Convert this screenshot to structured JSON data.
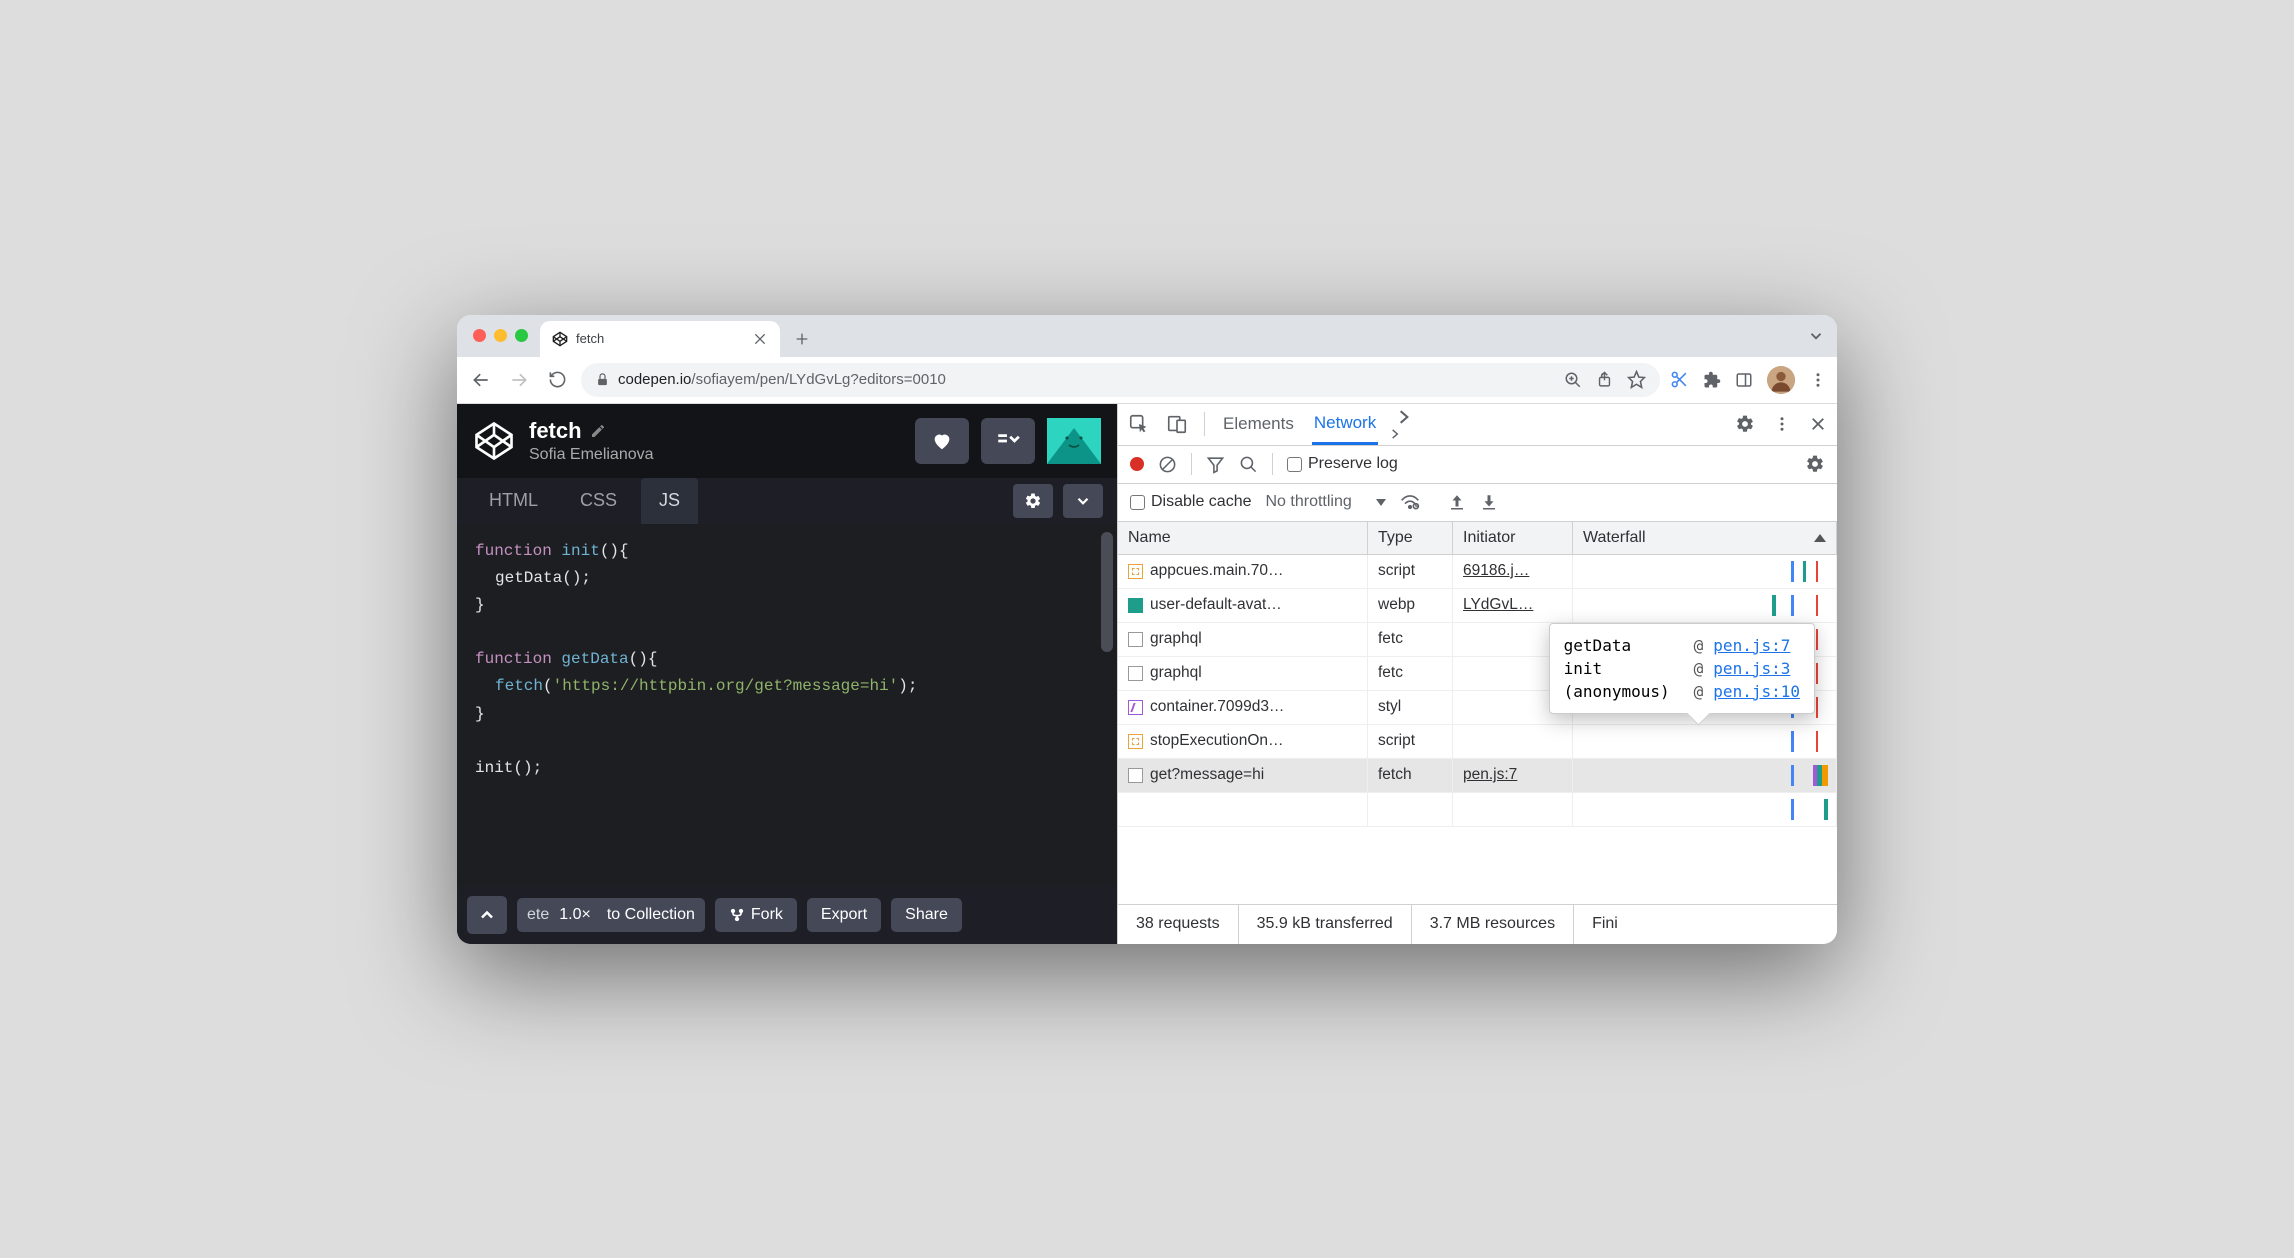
{
  "browser": {
    "tab_title": "fetch",
    "url_domain": "codepen.io",
    "url_path": "/sofiayem/pen/LYdGvLg?editors=0010"
  },
  "codepen": {
    "title": "fetch",
    "author": "Sofia Emelianova",
    "tabs": {
      "html": "HTML",
      "css": "CSS",
      "js": "JS"
    },
    "footer": {
      "truncated": "ete",
      "zoom": "1.0×",
      "collection": "to Collection",
      "fork": "Fork",
      "export": "Export",
      "share": "Share"
    },
    "code": {
      "l1_kw": "function",
      "l1_fn": "init",
      "l1_rest": "(){",
      "l2": "getData();",
      "l3": "}",
      "l4_kw": "function",
      "l4_fn": "getData",
      "l4_rest": "(){",
      "l5_fn": "fetch",
      "l5_open": "(",
      "l5_str": "'https://httpbin.org/get?message=hi'",
      "l5_close": ");",
      "l6": "}",
      "l7": "init();"
    }
  },
  "devtools": {
    "tabs": {
      "elements": "Elements",
      "network": "Network"
    },
    "preserve_log": "Preserve log",
    "disable_cache": "Disable cache",
    "throttling": "No throttling",
    "columns": {
      "name": "Name",
      "type": "Type",
      "initiator": "Initiator",
      "waterfall": "Waterfall"
    },
    "rows": [
      {
        "name": "appcues.main.70…",
        "type": "script",
        "initiator": "69186.j…",
        "icon": "js"
      },
      {
        "name": "user-default-avat…",
        "type": "webp",
        "initiator": "LYdGvL…",
        "icon": "img"
      },
      {
        "name": "graphql",
        "type": "fetc",
        "initiator": "",
        "icon": "box"
      },
      {
        "name": "graphql",
        "type": "fetc",
        "initiator": "",
        "icon": "box"
      },
      {
        "name": "container.7099d3…",
        "type": "styl",
        "initiator": "",
        "icon": "css"
      },
      {
        "name": "stopExecutionOn…",
        "type": "script",
        "initiator": "",
        "icon": "js"
      },
      {
        "name": "get?message=hi",
        "type": "fetch",
        "initiator": "pen.js:7",
        "icon": "box",
        "selected": true
      }
    ],
    "stack": [
      {
        "fn": "getData",
        "loc": "pen.js:7"
      },
      {
        "fn": "init",
        "loc": "pen.js:3"
      },
      {
        "fn": "(anonymous)",
        "loc": "pen.js:10"
      }
    ],
    "at_symbol": "@",
    "status": {
      "requests": "38 requests",
      "transferred": "35.9 kB transferred",
      "resources": "3.7 MB resources",
      "finish": "Fini"
    }
  }
}
